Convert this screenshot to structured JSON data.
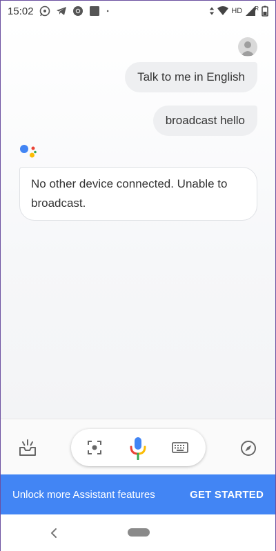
{
  "status_bar": {
    "time": "15:02",
    "network_label": "HD",
    "signal_label": "R"
  },
  "conversation": {
    "user_messages": [
      "Talk to me in English",
      "broadcast hello"
    ],
    "assistant_message": "No other device connected. Unable to broadcast."
  },
  "banner": {
    "text": "Unlock more Assistant features",
    "button_label": "GET STARTED"
  },
  "colors": {
    "accent": "#4285f4",
    "google_blue": "#4285f4",
    "google_red": "#ea4335",
    "google_yellow": "#fbbc05",
    "google_green": "#34a853"
  },
  "icons": {
    "left": "inbox-icon",
    "lens": "lens-icon",
    "mic": "mic-icon",
    "keyboard": "keyboard-icon",
    "right": "compass-icon"
  }
}
